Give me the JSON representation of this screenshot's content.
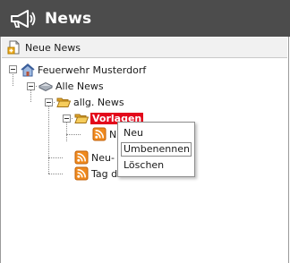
{
  "header": {
    "title": "News",
    "icon": "megaphone-icon"
  },
  "toolbar": {
    "new_news_label": "Neue News",
    "icon": "add-document-icon"
  },
  "tree": {
    "root": {
      "label": "Feuerwehr Musterdorf",
      "icon": "home-icon"
    },
    "all_news": {
      "label": "Alle News",
      "icon": "database-icon"
    },
    "general_news": {
      "label": "allg. News",
      "icon": "folder-open-icon"
    },
    "templates": {
      "label": "Vorlagen",
      "icon": "folder-open-icon",
      "selected": true
    },
    "template_child": {
      "label": "N",
      "icon": "rss-icon"
    },
    "new_item": {
      "label": "Neu-",
      "icon": "rss-icon"
    },
    "open_day": {
      "label": "Tag der offenen Tür",
      "icon": "rss-icon"
    }
  },
  "context_menu": {
    "items": [
      {
        "label": "Neu"
      },
      {
        "label": "Umbenennen",
        "hovered": true
      },
      {
        "label": "Löschen"
      }
    ]
  },
  "colors": {
    "header_bg": "#4c4c4c",
    "selected_bg": "#e3081b",
    "rss": "#f08a1e",
    "folder": "#f2b93a"
  }
}
